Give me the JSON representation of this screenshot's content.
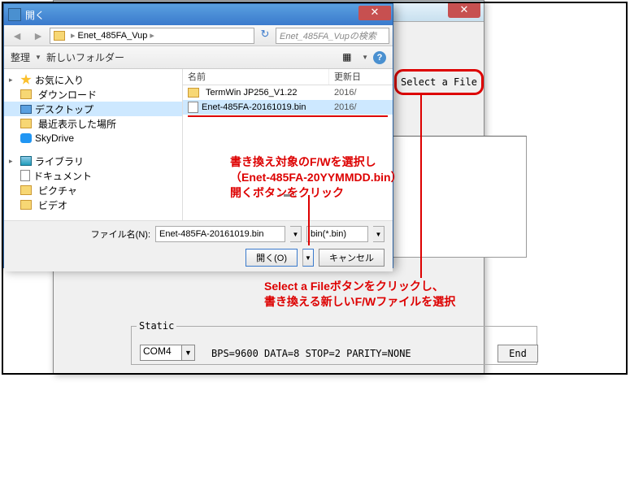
{
  "bg": {
    "close": "✕",
    "select_file_btn": "Select a File"
  },
  "static": {
    "legend": "Static",
    "com": "COM4",
    "params": "BPS=9600  DATA=8  STOP=2  PARITY=NONE",
    "end": "End"
  },
  "dialog": {
    "title": "開く",
    "close": "✕",
    "path": "Enet_485FA_Vup",
    "path_sep": "▸",
    "search_placeholder": "Enet_485FA_Vupの検索",
    "toolbar": {
      "organize": "整理",
      "newfolder": "新しいフォルダー"
    },
    "tree": {
      "fav": "お気に入り",
      "downloads": "ダウンロード",
      "desktop": "デスクトップ",
      "recent": "最近表示した場所",
      "skydrive": "SkyDrive",
      "libraries": "ライブラリ",
      "documents": "ドキュメント",
      "pictures": "ピクチャ",
      "videos": "ビデオ"
    },
    "cols": {
      "name": "名前",
      "date": "更新日"
    },
    "rows": [
      {
        "type": "folder",
        "name": "TermWin JP256_V1.22",
        "date": "2016/"
      },
      {
        "type": "file",
        "name": "Enet-485FA-20161019.bin",
        "date": "2016/"
      }
    ],
    "filename_label": "ファイル名(N):",
    "filename_value": "Enet-485FA-20161019.bin",
    "filter": "bin(*.bin)",
    "open_btn": "開く(O)",
    "cancel_btn": "キャンセル"
  },
  "annotations": {
    "a1_l1": "書き換え対象のF/Wを選択し",
    "a1_l2": "（Enet-485FA-20YYMMDD.bin）",
    "a1_l3": "開くボタンをクリック",
    "a2_l1": "Select a Fileボタンをクリックし、",
    "a2_l2": "書き換える新しいF/Wファイルを選択"
  }
}
